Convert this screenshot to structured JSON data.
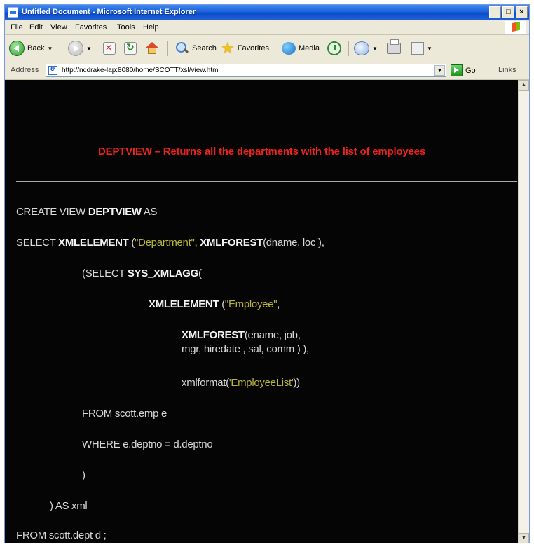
{
  "window": {
    "title": "Untitled Document - Microsoft Internet Explorer",
    "minimize": "_",
    "maximize": "□",
    "close": "×"
  },
  "menu": {
    "items": [
      "File",
      "Edit",
      "View",
      "Favorites",
      "Tools",
      "Help"
    ]
  },
  "toolbar": {
    "back": "Back",
    "search": "Search",
    "favorites": "Favorites",
    "media": "Media"
  },
  "address": {
    "label": "Address",
    "url": "http://ncdrake-lap:8080/home/SCOTT/xsl/view.html",
    "go": "Go",
    "links": "Links"
  },
  "page": {
    "heading": "DEPTVIEW – Returns all the departments with the list of employees",
    "lines": [
      {
        "pre": "CREATE VIEW ",
        "kw": "DEPTVIEW",
        "post": " AS"
      },
      {
        "kw1": "XMLELEMENT",
        "lit1": "\"Department\"",
        "kw2": "XMLFOREST",
        "pre": "SELECT ",
        "mid1": " (",
        "mid2": ", ",
        "post": "(dname, loc ),"
      },
      {
        "pre": "(SELECT ",
        "kw": "SYS_XMLAGG",
        "post": "("
      },
      {
        "kw": "XMLELEMENT",
        "mid": " (",
        "lit": "\"Employee\"",
        "post": ","
      },
      {
        "kw": "XMLFOREST",
        "post": "(ename, job,"
      },
      {
        "text": "mgr, hiredate , sal, comm ) ),"
      },
      {
        "pre": "xmlformat(",
        "lit": "'EmployeeList'",
        "post": "))"
      },
      {
        "text": "FROM scott.emp e"
      },
      {
        "text": "WHERE e.deptno = d.deptno"
      },
      {
        "text": ")"
      },
      {
        "text": ") AS xml"
      },
      {
        "text": "FROM scott.dept d ;"
      }
    ]
  }
}
